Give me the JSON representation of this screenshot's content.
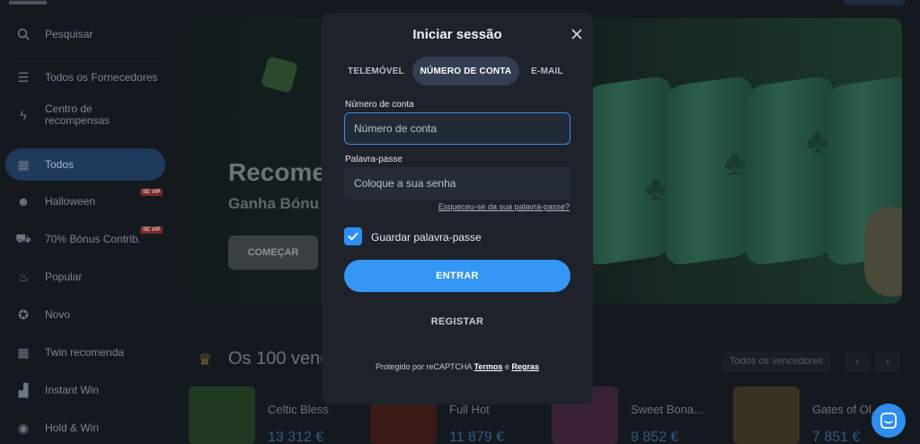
{
  "sidebar": {
    "items": [
      {
        "label": "Pesquisar",
        "icon": "search-icon"
      },
      {
        "label": "Todos os Fornecedores",
        "icon": "list-icon"
      },
      {
        "label": "Centro de recompensas",
        "icon": "bolt-icon"
      },
      {
        "label": "Todos",
        "icon": "grid-icon",
        "active": true
      },
      {
        "label": "Halloween",
        "icon": "pumpkin-icon",
        "badge": "SE VIP"
      },
      {
        "label": "70% Bónus Contrib.",
        "icon": "cart-icon",
        "badge": "SE VIP"
      },
      {
        "label": "Popular",
        "icon": "flame-icon"
      },
      {
        "label": "Novo",
        "icon": "new-icon"
      },
      {
        "label": "Twin recomenda",
        "icon": "grid-icon"
      },
      {
        "label": "Instant Win",
        "icon": "chart-icon"
      },
      {
        "label": "Hold & Win",
        "icon": "coins-icon"
      }
    ]
  },
  "banner": {
    "title": "Recome",
    "subtitle": "Ganha Bónu",
    "button": "COMEÇAR"
  },
  "winners": {
    "title": "Os 100 venc",
    "filter": "Todos os vencedores",
    "cards": [
      {
        "name": "Celtic Bless",
        "amount": "13 312 €"
      },
      {
        "name": "Full Hot",
        "amount": "11 879 €"
      },
      {
        "name": "Sweet Bona...",
        "amount": "9 852 €"
      },
      {
        "name": "Gates of Ol...",
        "amount": "7 851 €"
      }
    ]
  },
  "modal": {
    "title": "Iniciar sessão",
    "tabs": [
      {
        "label": "TELEMÓVEL",
        "active": false
      },
      {
        "label": "NÚMERO DE CONTA",
        "active": true
      },
      {
        "label": "E-MAIL",
        "active": false
      }
    ],
    "account_label": "Número de conta",
    "account_placeholder": "Número de conta",
    "password_label": "Palavra-passe",
    "password_placeholder": "Coloque a sua senha",
    "forgot_link": "Esqueceu-se da sua palavra-passe?",
    "remember_label": "Guardar palavra-passe",
    "remember_checked": true,
    "login_button": "ENTRAR",
    "register_button": "REGISTAR",
    "footer_prefix": "Protegido por reCAPTCHA",
    "footer_terms": "Termos",
    "footer_and": "e",
    "footer_rules": "Regras"
  },
  "colors": {
    "accent": "#3596f5",
    "modal_bg": "#1d222b",
    "page_bg": "#12161d"
  }
}
